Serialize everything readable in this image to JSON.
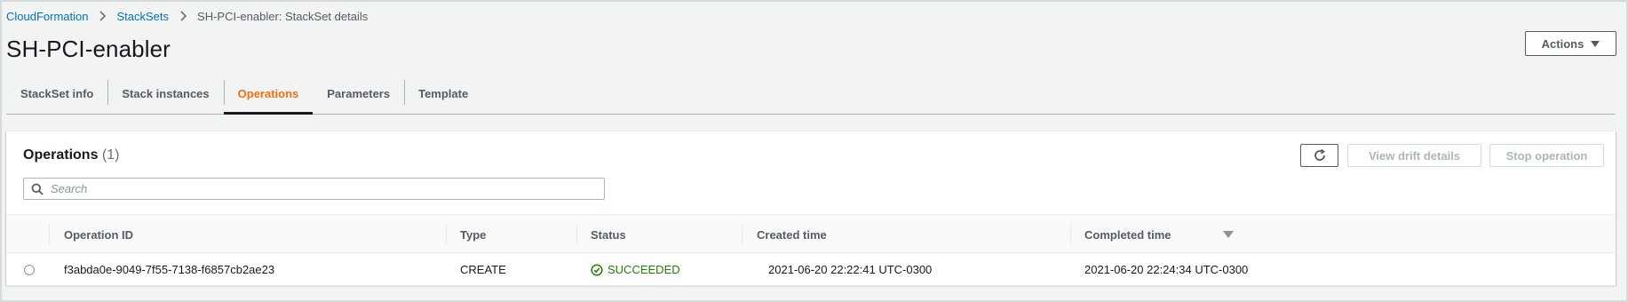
{
  "breadcrumb": {
    "items": [
      "CloudFormation",
      "StackSets"
    ],
    "current": "SH-PCI-enabler: StackSet details"
  },
  "header": {
    "title": "SH-PCI-enabler",
    "actions_label": "Actions"
  },
  "tabs": [
    {
      "label": "StackSet info",
      "active": false
    },
    {
      "label": "Stack instances",
      "active": false
    },
    {
      "label": "Operations",
      "active": true
    },
    {
      "label": "Parameters",
      "active": false
    },
    {
      "label": "Template",
      "active": false
    }
  ],
  "panel": {
    "title": "Operations",
    "count": "(1)",
    "view_drift_label": "View drift details",
    "stop_operation_label": "Stop operation",
    "search_placeholder": "Search"
  },
  "table": {
    "columns": [
      "Operation ID",
      "Type",
      "Status",
      "Created time",
      "Completed time"
    ],
    "rows": [
      {
        "operation_id": "f3abda0e-9049-7f55-7138-f6857cb2ae23",
        "type": "CREATE",
        "status": "SUCCEEDED",
        "created_time": "2021-06-20 22:22:41 UTC-0300",
        "completed_time": "2021-06-20 22:24:34 UTC-0300"
      }
    ]
  },
  "colors": {
    "link": "#0073bb",
    "active_tab": "#ec7211",
    "success": "#1d8102"
  },
  "icons": {
    "breadcrumb_separator": "chevron-right-icon",
    "actions_caret": "caret-down-icon",
    "refresh": "refresh-icon",
    "search": "search-icon",
    "status": "check-circle-icon",
    "sort": "sort-caret-icon"
  }
}
